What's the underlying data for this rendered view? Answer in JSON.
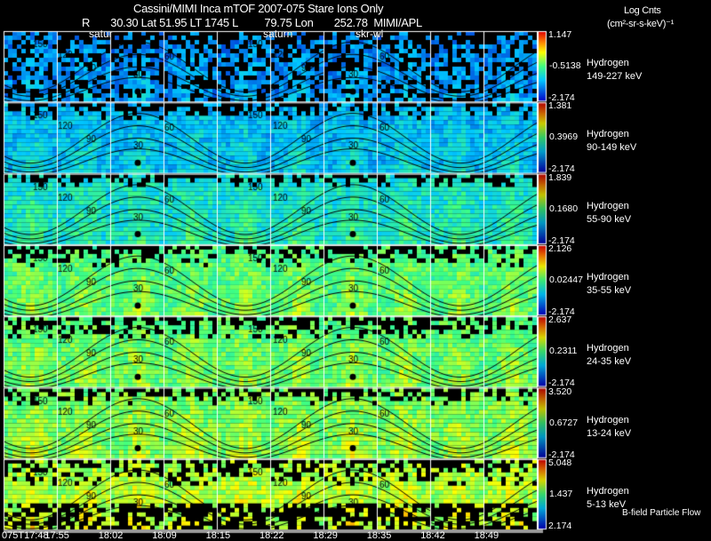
{
  "header": {
    "title": "Cassini/MIMI Inca mTOF  2007-075   Stare   Ions Only",
    "subtitle": "R       30.30 Lat 51.95 LT 1745 L         79.75 Lon       252.78  MIMI/APL",
    "units_line1": "Log Cnts",
    "units_line2": "(cm²-sr-s-keV)⁻¹"
  },
  "overlay_labels": [
    "satur",
    "saturn",
    "skr-wl"
  ],
  "footer_label": "B-field Particle Flow",
  "chart_data": {
    "type": "heatmap",
    "title": "Cassini/MIMI Inca mTOF  2007-075   Stare   Ions Only",
    "x_tick_labels": [
      "075T17:48",
      "17:55",
      "18:02",
      "18:09",
      "18:15",
      "18:22",
      "18:29",
      "18:35",
      "18:42",
      "18:49"
    ],
    "contour_labels": [
      "30",
      "60",
      "90",
      "120",
      "150"
    ],
    "colormap": [
      "#0000c8",
      "#00c8ff",
      "#40ff80",
      "#ffff00",
      "#ff8000",
      "#e00000"
    ],
    "rows": [
      {
        "species": "Hydrogen",
        "energy": "149-227 keV",
        "max": "1.147",
        "mid": "-0.5138",
        "min": "-2.174"
      },
      {
        "species": "Hydrogen",
        "energy": "90-149 keV",
        "max": "1.381",
        "mid": "0.3969",
        "min": "-2.174"
      },
      {
        "species": "Hydrogen",
        "energy": "55-90 keV",
        "max": "1.839",
        "mid": "0.1680",
        "min": "-2.174"
      },
      {
        "species": "Hydrogen",
        "energy": "35-55 keV",
        "max": "2.126",
        "mid": "0.02447",
        "min": "-2.174"
      },
      {
        "species": "Hydrogen",
        "energy": "24-35 keV",
        "max": "2.637",
        "mid": "0.2311",
        "min": "-2.174"
      },
      {
        "species": "Hydrogen",
        "energy": "13-24 keV",
        "max": "3.520",
        "mid": "0.6727",
        "min": "-2.174"
      },
      {
        "species": "Hydrogen",
        "energy": "5-13 keV",
        "max": "5.048",
        "mid": "1.437",
        "min": "2.174"
      }
    ]
  }
}
